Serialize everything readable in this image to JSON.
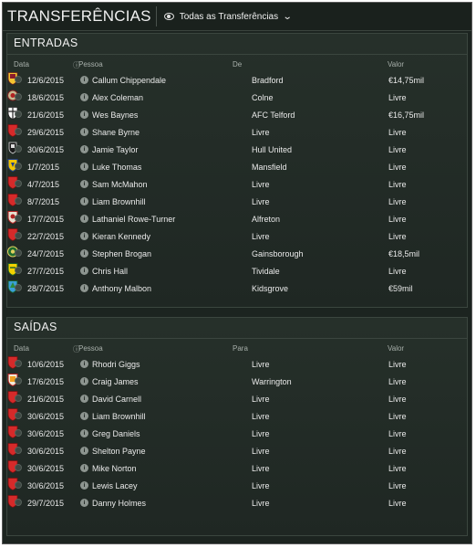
{
  "header": {
    "title": "TRANSFERÊNCIAS",
    "filter_label": "Todas as Transferências"
  },
  "entradas": {
    "title": "ENTRADAS",
    "columns": {
      "date": "Data",
      "person": "Pessoa",
      "club": "De",
      "value": "Valor"
    },
    "rows": [
      {
        "date": "12/6/2015",
        "person": "Callum Chippendale",
        "club": "Bradford",
        "value": "€14,75mil",
        "crest": "bradford"
      },
      {
        "date": "18/6/2015",
        "person": "Alex Coleman",
        "club": "Colne",
        "value": "Livre",
        "crest": "colne"
      },
      {
        "date": "21/6/2015",
        "person": "Wes Baynes",
        "club": "AFC Telford",
        "value": "€16,75mil",
        "crest": "telford"
      },
      {
        "date": "29/6/2015",
        "person": "Shane Byrne",
        "club": "Livre",
        "value": "Livre",
        "crest": "free"
      },
      {
        "date": "30/6/2015",
        "person": "Jamie Taylor",
        "club": "Hull United",
        "value": "Livre",
        "crest": "hull"
      },
      {
        "date": "1/7/2015",
        "person": "Luke Thomas",
        "club": "Mansfield",
        "value": "Livre",
        "crest": "mansfield"
      },
      {
        "date": "4/7/2015",
        "person": "Sam McMahon",
        "club": "Livre",
        "value": "Livre",
        "crest": "free"
      },
      {
        "date": "8/7/2015",
        "person": "Liam Brownhill",
        "club": "Livre",
        "value": "Livre",
        "crest": "free"
      },
      {
        "date": "17/7/2015",
        "person": "Lathaniel Rowe-Turner",
        "club": "Alfreton",
        "value": "Livre",
        "crest": "alfreton"
      },
      {
        "date": "22/7/2015",
        "person": "Kieran Kennedy",
        "club": "Livre",
        "value": "Livre",
        "crest": "free"
      },
      {
        "date": "24/7/2015",
        "person": "Stephen Brogan",
        "club": "Gainsborough",
        "value": "€18,5mil",
        "crest": "gainsborough"
      },
      {
        "date": "27/7/2015",
        "person": "Chris Hall",
        "club": "Tividale",
        "value": "Livre",
        "crest": "tividale"
      },
      {
        "date": "28/7/2015",
        "person": "Anthony Malbon",
        "club": "Kidsgrove",
        "value": "€59mil",
        "crest": "kidsgrove"
      }
    ]
  },
  "saidas": {
    "title": "SAÍDAS",
    "columns": {
      "date": "Data",
      "person": "Pessoa",
      "club": "Para",
      "value": "Valor"
    },
    "rows": [
      {
        "date": "10/6/2015",
        "person": "Rhodri Giggs",
        "club": "Livre",
        "value": "Livre",
        "crest": "free"
      },
      {
        "date": "17/6/2015",
        "person": "Craig James",
        "club": "Warrington",
        "value": "Livre",
        "crest": "warrington"
      },
      {
        "date": "21/6/2015",
        "person": "David Carnell",
        "club": "Livre",
        "value": "Livre",
        "crest": "free"
      },
      {
        "date": "30/6/2015",
        "person": "Liam Brownhill",
        "club": "Livre",
        "value": "Livre",
        "crest": "free"
      },
      {
        "date": "30/6/2015",
        "person": "Greg Daniels",
        "club": "Livre",
        "value": "Livre",
        "crest": "free"
      },
      {
        "date": "30/6/2015",
        "person": "Shelton Payne",
        "club": "Livre",
        "value": "Livre",
        "crest": "free"
      },
      {
        "date": "30/6/2015",
        "person": "Mike Norton",
        "club": "Livre",
        "value": "Livre",
        "crest": "free"
      },
      {
        "date": "30/6/2015",
        "person": "Lewis Lacey",
        "club": "Livre",
        "value": "Livre",
        "crest": "free"
      },
      {
        "date": "29/7/2015",
        "person": "Danny Holmes",
        "club": "Livre",
        "value": "Livre",
        "crest": "free"
      }
    ]
  },
  "colors": {
    "background": "#1c2420",
    "free_crest": "#d62a2a",
    "text": "#eaeaea"
  }
}
